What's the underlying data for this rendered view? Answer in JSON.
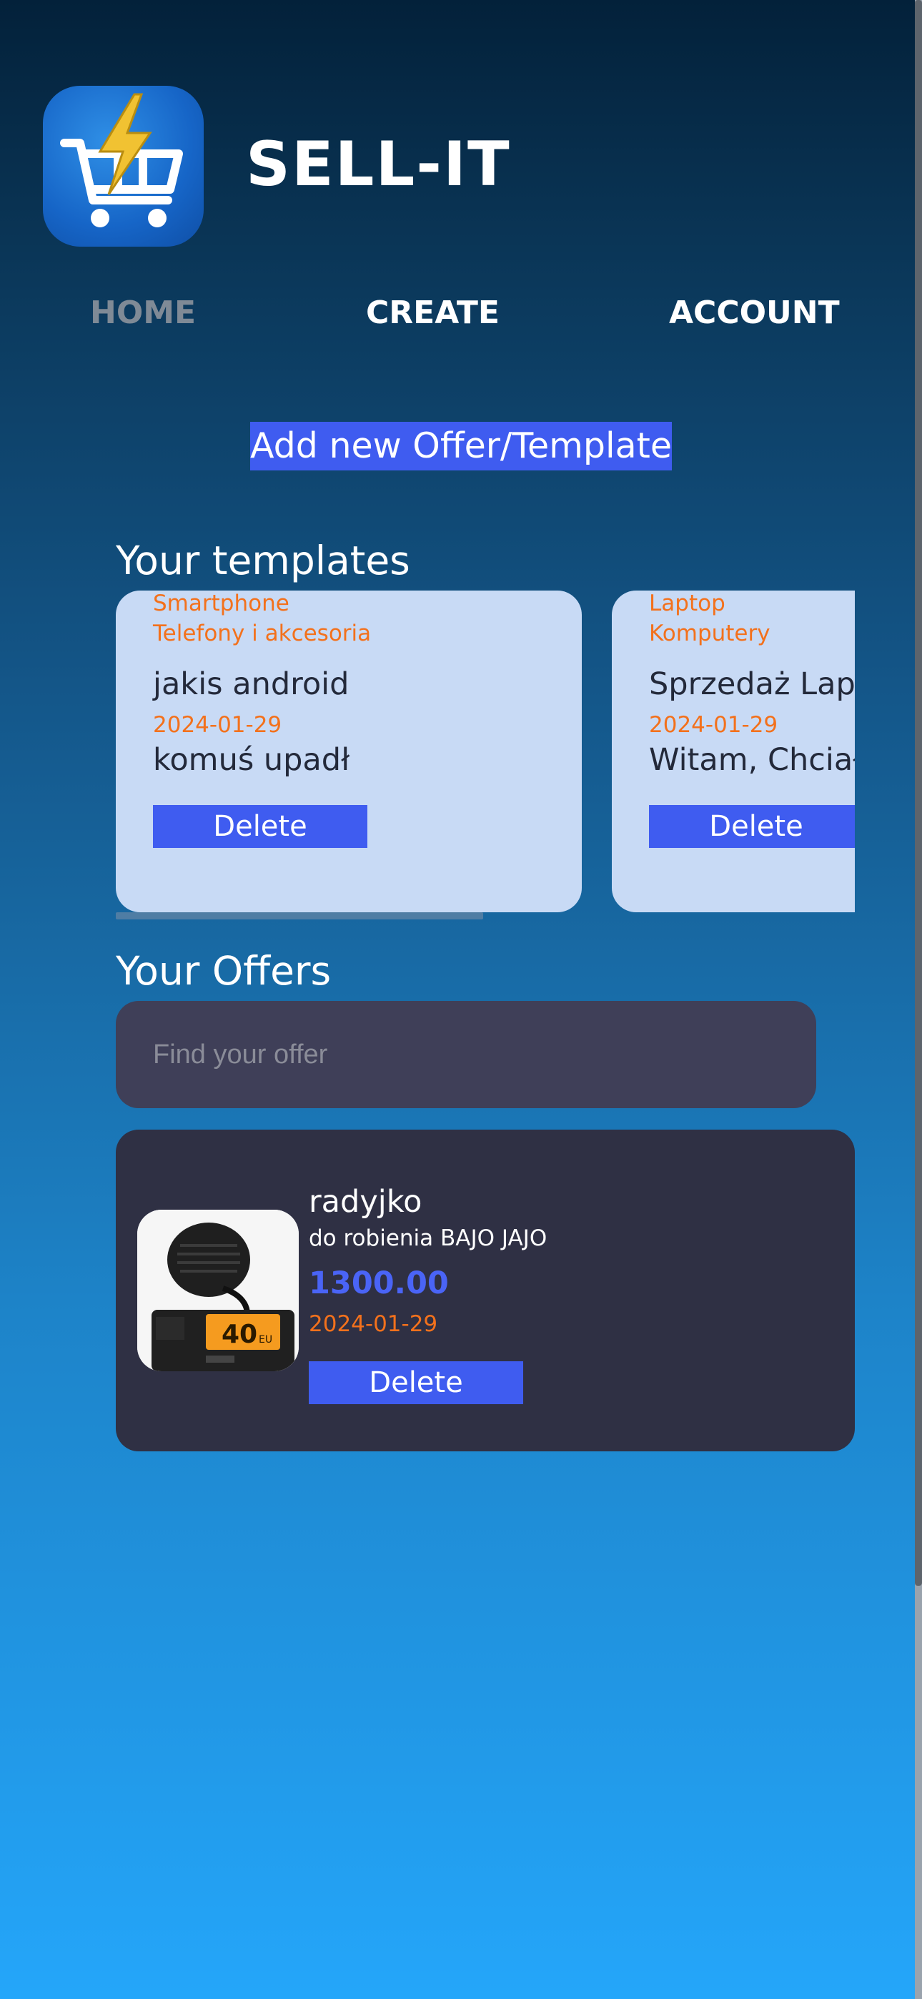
{
  "app": {
    "title": "SELL-IT",
    "logo_icon": "lightning-cart-icon"
  },
  "nav": {
    "home": "HOME",
    "create": "CREATE",
    "account": "ACCOUNT"
  },
  "actions": {
    "add_new": "Add new Offer/Template"
  },
  "templates": {
    "title": "Your templates",
    "items": [
      {
        "category": "Smartphone",
        "parent_category": "Telefony i akcesoria",
        "name": "jakis android",
        "date": "2024-01-29",
        "description": "komuś upadł",
        "delete_label": "Delete"
      },
      {
        "category": "Laptop",
        "parent_category": "Komputery",
        "name": "Sprzedaż Laptopa",
        "date": "2024-01-29",
        "description": "Witam, Chciałbym",
        "delete_label": "Delete"
      }
    ]
  },
  "offers": {
    "title": "Your Offers",
    "search_placeholder": "Find your offer",
    "items": [
      {
        "title": "radyjko",
        "description": "do robienia BAJO JAJO",
        "price": "1300.00",
        "date": "2024-01-29",
        "delete_label": "Delete",
        "image_icon": "cb-radio-image"
      }
    ]
  },
  "colors": {
    "accent": "#3f5cf0",
    "highlight": "#f3711c",
    "price": "#4a64f6",
    "card_light": "#c8daf5",
    "card_dark": "#2f3044"
  }
}
